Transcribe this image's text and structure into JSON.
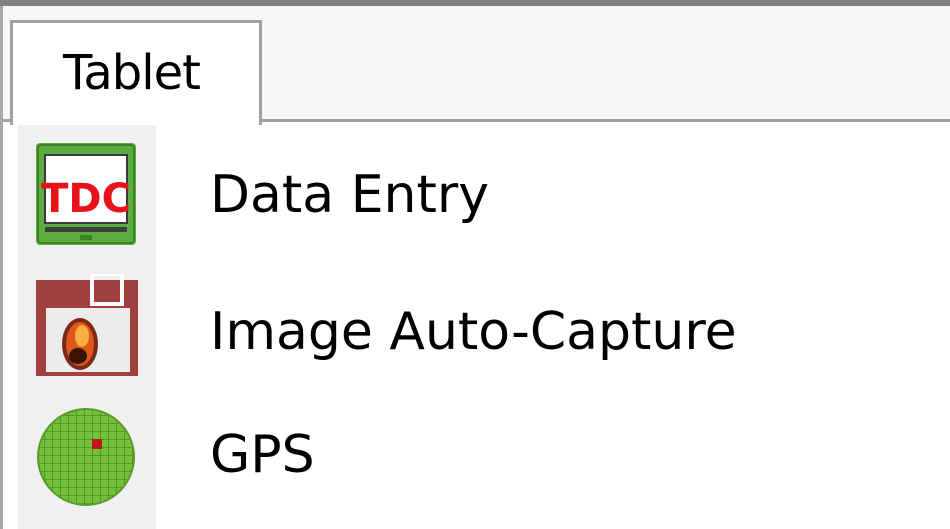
{
  "tabs": [
    {
      "label": "Tablet"
    }
  ],
  "menu": {
    "items": [
      {
        "label": "Data Entry",
        "icon": "tdc-screen-icon"
      },
      {
        "label": "Image Auto-Capture",
        "icon": "camera-icon"
      },
      {
        "label": "GPS",
        "icon": "gps-globe-icon"
      }
    ]
  },
  "icons": {
    "tdc_text": "TDC"
  },
  "colors": {
    "tdc_green": "#5cae3c",
    "tdc_red": "#e8121a",
    "camera_brown": "#a0413f",
    "gps_green": "#73c13a"
  }
}
